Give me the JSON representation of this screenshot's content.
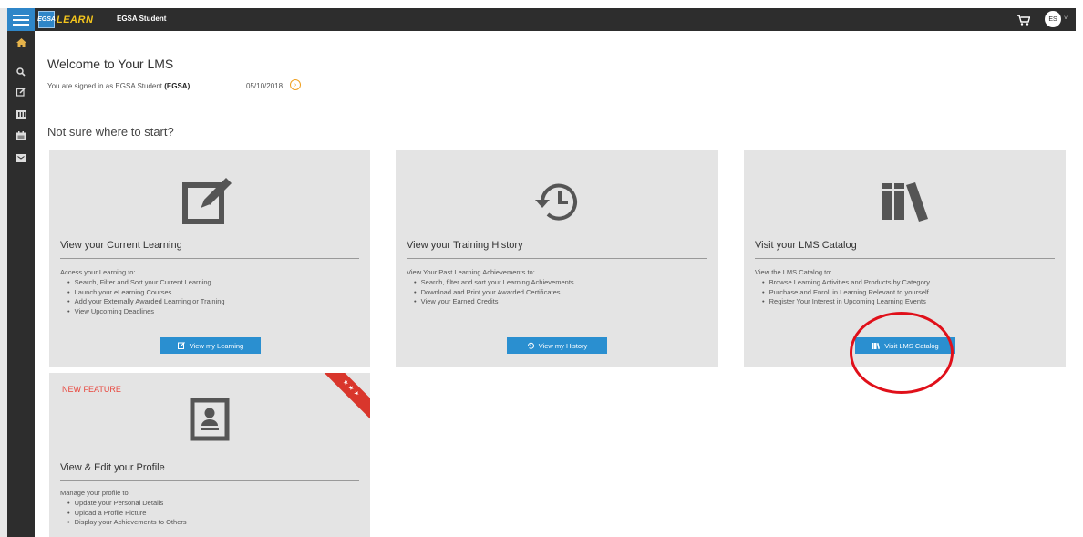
{
  "topbar": {
    "logo_box": "EGSA",
    "logo_text": "LEARN",
    "user_name": "EGSA Student",
    "avatar_initials": "ES",
    "caret": "˅"
  },
  "header": {
    "title": "Welcome to Your LMS",
    "signed_in_prefix": "You are signed in as EGSA Student ",
    "signed_in_code": "(EGSA)",
    "date": "05/10/2018",
    "date_btn_glyph": "›"
  },
  "start_heading": "Not sure where to start?",
  "cards": [
    {
      "title": "View your Current Learning",
      "desc": "Access your Learning to:",
      "items": [
        "Search, Filter and Sort your Current Learning",
        "Launch your eLearning Courses",
        "Add your Externally Awarded Learning or Training",
        "View Upcoming Deadlines"
      ],
      "button": "View my Learning"
    },
    {
      "title": "View your Training History",
      "desc": "View Your Past Learning Achievements to:",
      "items": [
        "Search, filter and sort your Learning Achievements",
        "Download and Print your Awarded Certificates",
        "View your Earned Credits"
      ],
      "button": "View my History"
    },
    {
      "title": "Visit your LMS Catalog",
      "desc": "View the LMS Catalog to:",
      "items": [
        "Browse Learning Activities and Products by Category",
        "Purchase and Enroll in Learning Relevant to yourself",
        "Register Your Interest in Upcoming Learning Events"
      ],
      "button": "Visit LMS Catalog"
    },
    {
      "badge": "NEW FEATURE",
      "ribbon": "★★★",
      "title": "View & Edit your Profile",
      "desc": "Manage your profile to:",
      "items": [
        "Update your Personal Details",
        "Upload a Profile Picture",
        "Display your Achievements to Others"
      ]
    }
  ],
  "colors": {
    "topbar": "#2d2d2d",
    "accent": "#2a8fd0",
    "card_bg": "#e4e4e4",
    "new_feature": "#e8453c",
    "highlight": "#e0101a"
  }
}
